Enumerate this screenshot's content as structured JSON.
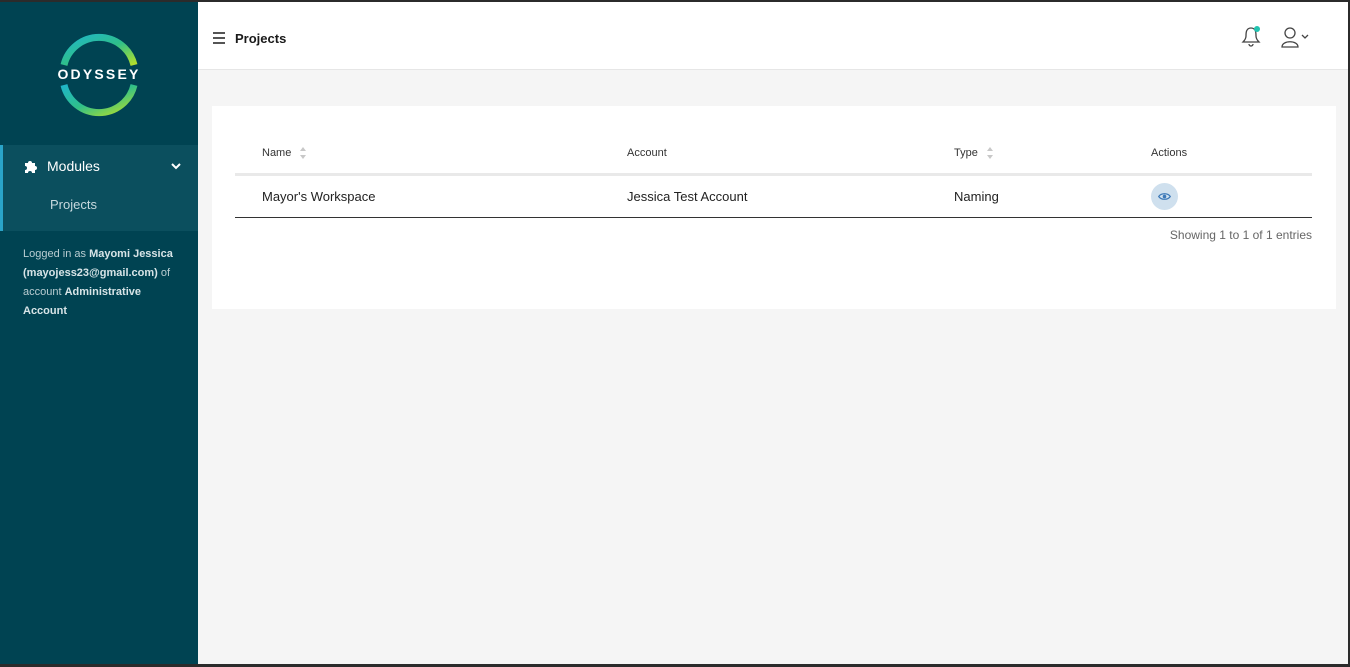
{
  "brand": {
    "logo_text": "ODYSSEY"
  },
  "sidebar": {
    "module_group": {
      "label": "Modules",
      "items": [
        {
          "label": "Projects"
        }
      ]
    },
    "login": {
      "prefix": "Logged in as ",
      "user": "Mayomi Jessica",
      "email": "(mayojess23@gmail.com)",
      "mid": " of account ",
      "account": "Administrative Account"
    }
  },
  "header": {
    "title": "Projects"
  },
  "table": {
    "columns": [
      {
        "label": "Name"
      },
      {
        "label": "Account"
      },
      {
        "label": "Type"
      },
      {
        "label": "Actions"
      }
    ],
    "rows": [
      {
        "name": "Mayor's Workspace",
        "account": "Jessica Test Account",
        "type": "Naming"
      }
    ],
    "info": "Showing 1 to 1 of 1 entries"
  },
  "colors": {
    "sidebar_bg": "#004352",
    "accent": "#2aa4c8",
    "notification_dot": "#22c3b0",
    "eye_button_bg": "#cfe0ee"
  },
  "icons": [
    "hamburger-icon",
    "bell-icon",
    "user-icon",
    "chevron-down-icon",
    "puzzle-icon",
    "eye-icon",
    "sort-icon"
  ]
}
